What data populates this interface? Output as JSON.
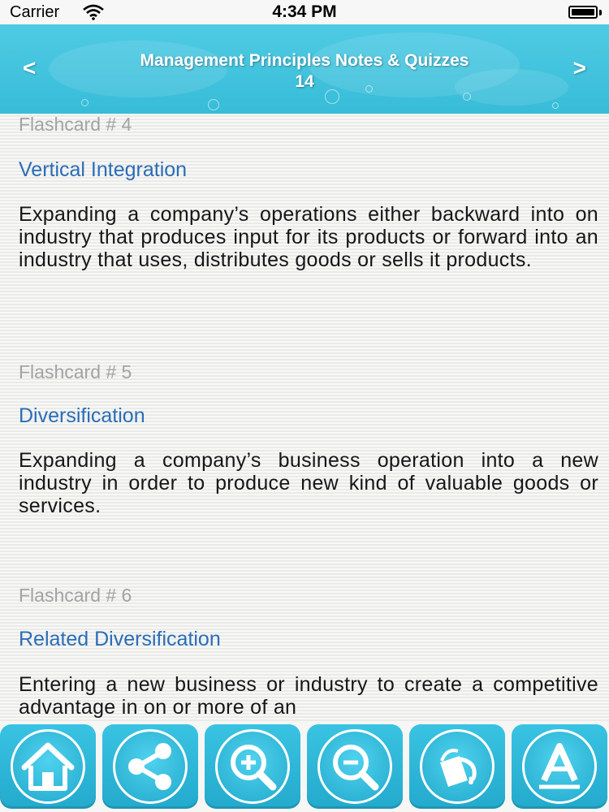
{
  "status_bar": {
    "carrier": "Carrier",
    "time": "4:34 PM"
  },
  "header": {
    "title_line1": "Management Principles Notes & Quizzes",
    "title_line2": "14",
    "prev_label": "<",
    "next_label": ">"
  },
  "flashcards": [
    {
      "label": "Flashcard # 4",
      "term": "Vertical Integration",
      "definition": "Expanding a company’s operations either backward into on industry that produces input for its products or forward into an industry that uses, distributes goods or sells it products."
    },
    {
      "label": "Flashcard # 5",
      "term": "Diversification",
      "definition": "Expanding a company’s business operation into a new industry in order to produce new kind of valuable goods or services."
    },
    {
      "label": "Flashcard # 6",
      "term": "Related Diversification",
      "definition": "Entering a new business or industry to create a competitive advantage in on or more of an"
    }
  ],
  "toolbar": {
    "icons": [
      "home-icon",
      "share-icon",
      "zoom-in-icon",
      "zoom-out-icon",
      "paint-bucket-icon",
      "font-icon"
    ]
  },
  "colors": {
    "header": "#3cc0dc",
    "term_blue": "#2a6db7",
    "label_gray": "#a3a3a3",
    "button": "#2cb5d6"
  }
}
